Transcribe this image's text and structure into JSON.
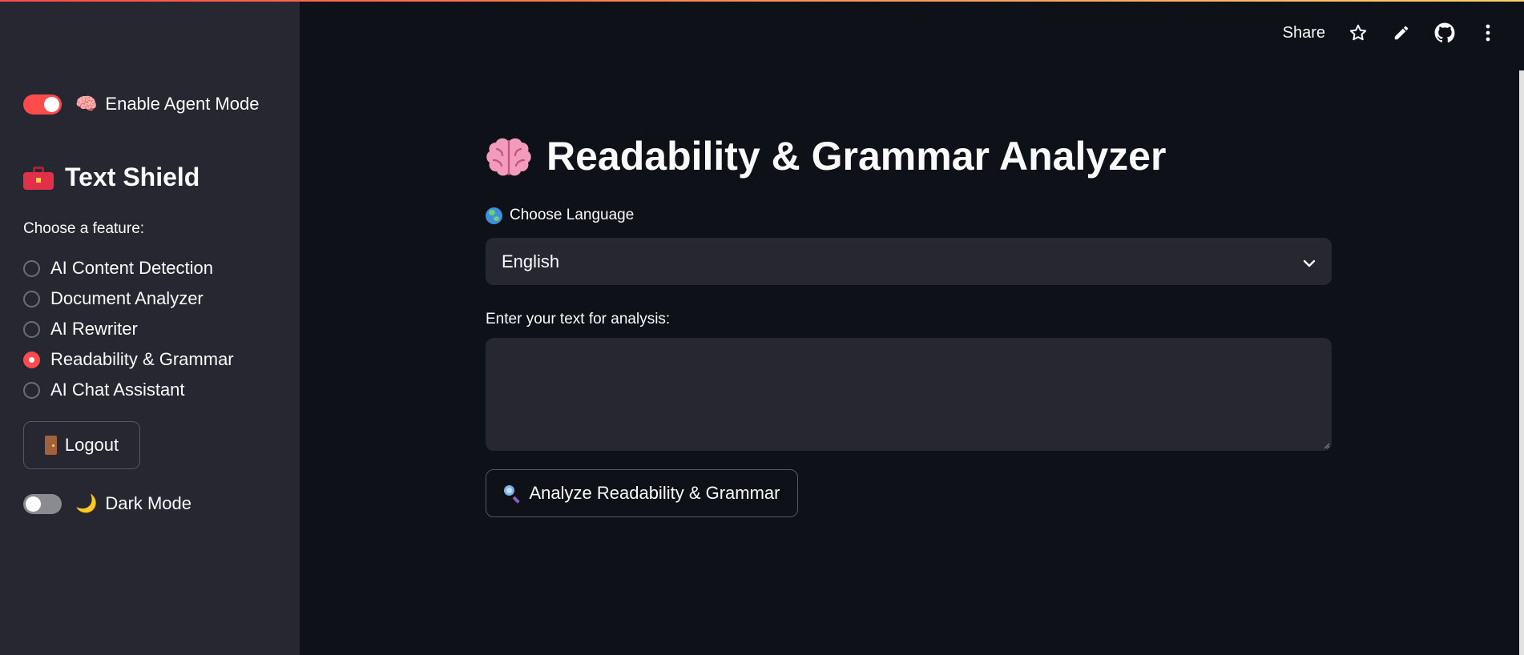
{
  "header": {
    "share_label": "Share",
    "icons": [
      "star-icon",
      "pencil-icon",
      "github-icon",
      "kebab-menu-icon"
    ]
  },
  "sidebar": {
    "agent_mode": {
      "label": "Enable Agent Mode",
      "emoji": "🧠",
      "enabled": true
    },
    "brand": {
      "title": "Text Shield",
      "icon": "toolbox-icon"
    },
    "feature_prompt": "Choose a feature:",
    "features": [
      {
        "label": "AI Content Detection",
        "selected": false
      },
      {
        "label": "Document Analyzer",
        "selected": false
      },
      {
        "label": "AI Rewriter",
        "selected": false
      },
      {
        "label": "Readability & Grammar",
        "selected": true
      },
      {
        "label": "AI Chat Assistant",
        "selected": false
      }
    ],
    "logout_label": "Logout",
    "dark_mode": {
      "label": "Dark Mode",
      "emoji": "🌙",
      "enabled": false
    }
  },
  "main": {
    "title": "Readability & Grammar Analyzer",
    "language_label": "Choose Language",
    "language_value": "English",
    "text_label": "Enter your text for analysis:",
    "text_value": "",
    "analyze_label": "Analyze Readability & Grammar"
  },
  "colors": {
    "accent": "#ff4b4b",
    "sidebar_bg": "#262730",
    "main_bg": "#0e1117",
    "text": "#fafafa"
  }
}
